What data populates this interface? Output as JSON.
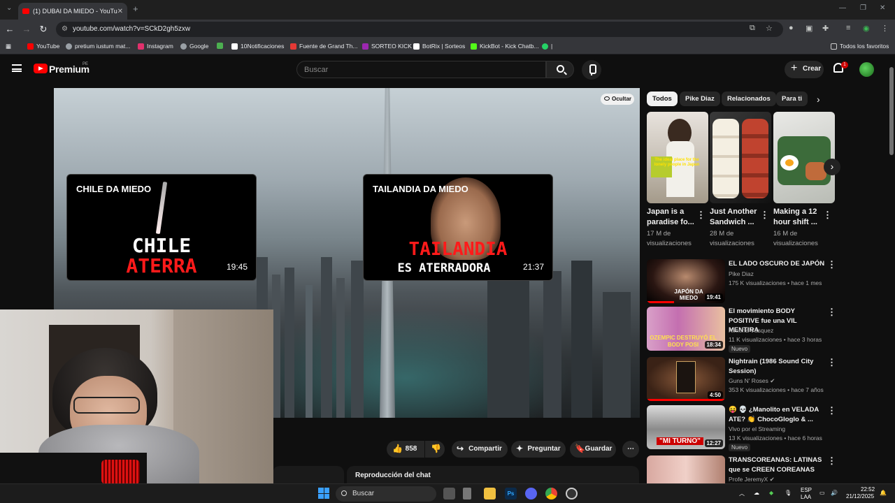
{
  "browser": {
    "tab_title": "(1) DUBAI DA MIEDO - YouTube",
    "url": "youtube.com/watch?v=SCkD2gh5zxw",
    "bookmarks": [
      {
        "label": "YouTube",
        "color": "#ff0000"
      },
      {
        "label": "pretium iustum mat...",
        "color": "#9aa0a6"
      },
      {
        "label": "Instagram",
        "color": "#e1306c"
      },
      {
        "label": "Google",
        "color": "#9aa0a6"
      },
      {
        "label": "",
        "color": "#4caf50"
      },
      {
        "label": "10Notificaciones",
        "color": "#ffffff"
      },
      {
        "label": "Fuente de Grand Th...",
        "color": "#e53935"
      },
      {
        "label": "SORTEO KICK",
        "color": "#9c27b0"
      },
      {
        "label": "BotRix | Sorteos",
        "color": "#ffffff"
      },
      {
        "label": "KickBot - Kick Chatb...",
        "color": "#53fc18"
      },
      {
        "label": "|",
        "color": "#25d366"
      }
    ],
    "all_bookmarks": "Todos los favoritos"
  },
  "header": {
    "brand": "Premium",
    "region": "PE",
    "search_placeholder": "Buscar",
    "create_label": "Crear",
    "notif_count": "1"
  },
  "player": {
    "hide_label": "Ocultar",
    "endcards": [
      {
        "title": "CHILE DA MIEDO",
        "big1": "CHILE",
        "big2": "ATERRA",
        "duration": "19:45"
      },
      {
        "title": "TAILANDIA DA MIEDO",
        "big1": "TAILANDIA",
        "big2": "ES ATERRADORA",
        "duration": "21:37"
      }
    ]
  },
  "actions": {
    "likes": "858",
    "share": "Compartir",
    "ask": "Preguntar",
    "save": "Guardar"
  },
  "chat": {
    "replay_label": "Reproducción del chat"
  },
  "chips": [
    "Todos",
    "Pike Diaz",
    "Relacionados",
    "Para ti"
  ],
  "shorts": [
    {
      "title": "Japan is a paradise fo...",
      "views": "17 M de visualizaciones",
      "overlay": "The ideal place for the lonely people in Japan"
    },
    {
      "title": "Just Another Sandwich ...",
      "views": "28 M de visualizaciones"
    },
    {
      "title": "Making a 12 hour shift ...",
      "views": "16 M de visualizaciones"
    }
  ],
  "recommendations": [
    {
      "title": "EL LADO OSCURO DE JAPÓN",
      "channel": "Pike Diaz",
      "meta": "175 K visualizaciones • hace 1 mes",
      "duration": "19:41",
      "thumb_text": "JAPÓN DA MIEDO",
      "new": "",
      "progress": 0.35
    },
    {
      "title": "El movimiento BODY POSITIVE fue una VIL MENTIRA",
      "channel": "Ximena Vásquez",
      "meta": "11 K visualizaciones • hace 3 horas",
      "duration": "18:34",
      "thumb_text": "OZEMPIC DESTRUYÓ EL BODY POSI",
      "new": "Nuevo",
      "progress": 0
    },
    {
      "title": "Nightrain (1986 Sound City Session)",
      "channel": "Guns N' Roses ✔",
      "meta": "353 K visualizaciones • hace 7 años",
      "duration": "4:50",
      "thumb_text": "",
      "new": "",
      "progress": 1.0
    },
    {
      "title": "😝 💀 ¿Manolito en VELADA ATE? 👏 ChocoGloglo & ...",
      "channel": "Vivo por el Streaming",
      "meta": "13 K visualizaciones • hace 6 horas",
      "duration": "12:27",
      "thumb_text": "\"MI TURNO\"",
      "new": "Nuevo",
      "progress": 0
    },
    {
      "title": "TRANSCOREANAS: LATINAS que se CREEN COREANAS",
      "channel": "Profe JeremyX ✔",
      "meta": "",
      "duration": "",
      "thumb_text": "",
      "new": "",
      "progress": 0
    }
  ],
  "taskbar": {
    "search": "Buscar",
    "lang1": "ESP",
    "lang2": "LAA",
    "time": "22:52",
    "date": "21/12/2025"
  }
}
